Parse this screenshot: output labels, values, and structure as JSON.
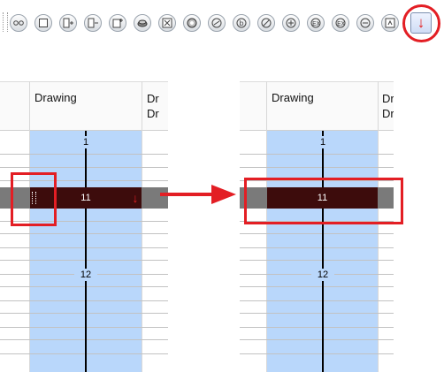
{
  "toolbar": {
    "icons": [
      "onion-skin-icon",
      "light-table-icon",
      "add-drawing-icon",
      "duplicate-drawing-icon",
      "insert-keyframe-icon",
      "stop-motion-keyframe-icon",
      "cycle-icon",
      "drawing-substitution-icon",
      "motion-keyframe-icon",
      "constant-segment-icon",
      "fill-icon",
      "clone-icon",
      "extend-exposure-icon",
      "remove-exposure-icon",
      "set-exposure-icon",
      "extend-exposure-down-icon"
    ],
    "active_button_glyph": "↓",
    "highlight_color": "#e31e24"
  },
  "left_panel": {
    "column_header": "Drawing",
    "next_column_header_line1": "Dr",
    "next_column_header_line2": "Dr",
    "frame_labels": {
      "first": "1",
      "selected": "11",
      "later": "12"
    },
    "selected_row_marker": "↓"
  },
  "right_panel": {
    "column_header": "Drawing",
    "next_column_header_line1": "Draw",
    "next_column_header_line2": "Draw",
    "frame_labels": {
      "first": "1",
      "selected": "11",
      "later": "12"
    }
  },
  "colors": {
    "drawing_column": "#b9d7fb",
    "selected_cell": "#3d0c0c",
    "selected_row": "#7a7a7a",
    "callout_red": "#e31e24"
  }
}
